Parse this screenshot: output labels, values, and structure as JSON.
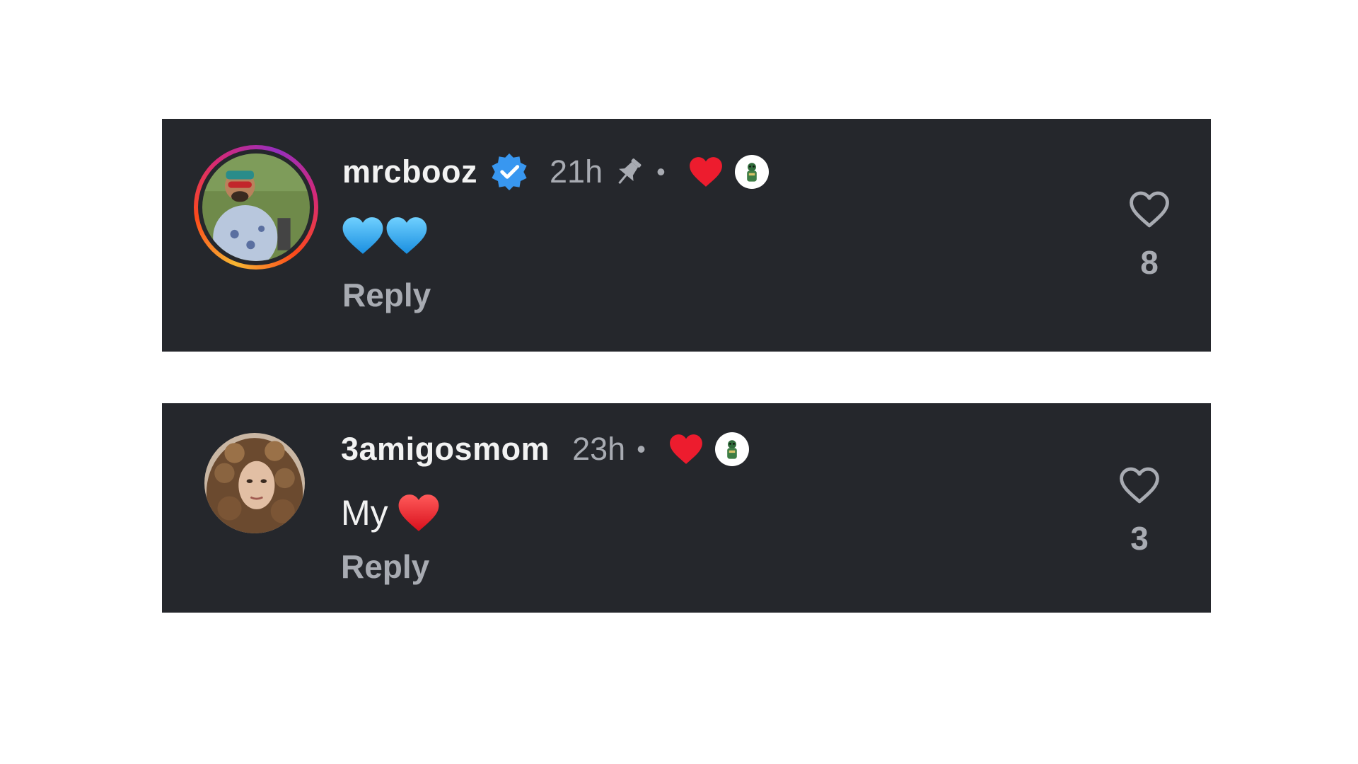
{
  "comments": [
    {
      "username": "mrcbooz",
      "verified": true,
      "timestamp": "21h",
      "pinned": true,
      "separator": "•",
      "text": "",
      "emojis": [
        "blue-heart",
        "blue-heart"
      ],
      "reply_label": "Reply",
      "like_count": "8",
      "avatar_icon": "avatar-man-with-sunglasses",
      "has_story_ring": true
    },
    {
      "username": "3amigosmom",
      "verified": false,
      "timestamp": "23h",
      "pinned": false,
      "separator": "•",
      "text": "My",
      "emojis": [
        "red-heart"
      ],
      "reply_label": "Reply",
      "like_count": "3",
      "avatar_icon": "avatar-woman-curly-hair",
      "has_story_ring": false
    }
  ],
  "colors": {
    "card_background": "#25272c",
    "page_background": "#ffffff",
    "primary_text": "#f2f2f2",
    "secondary_text": "#a8abb2",
    "verified_blue": "#3897f0",
    "reacted_heart": "#ed1c2e",
    "blue_heart": "#3fb6ff"
  }
}
